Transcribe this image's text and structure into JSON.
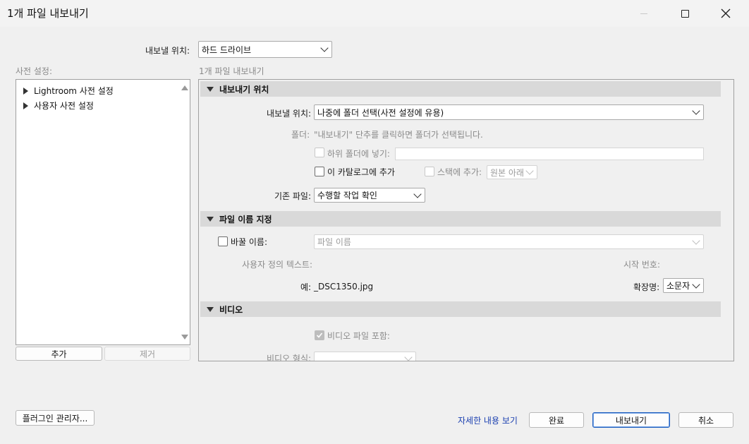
{
  "window": {
    "title": "1개 파일 내보내기"
  },
  "export_to": {
    "label": "내보낼 위치:",
    "value": "하드 드라이브"
  },
  "presets": {
    "header": "사전 설정:",
    "items": [
      {
        "label": "Lightroom 사전 설정"
      },
      {
        "label": "사용자 사전 설정"
      }
    ],
    "add_label": "추가",
    "remove_label": "제거"
  },
  "main": {
    "subtitle": "1개 파일 내보내기",
    "sections": {
      "location": {
        "title": "내보내기 위치",
        "export_to_label": "내보낼 위치:",
        "export_to_value": "나중에 폴더 선택(사전 설정에 유용)",
        "folder_label": "폴더:",
        "folder_hint": "\"내보내기\" 단추를 클릭하면 폴더가 선택됩니다.",
        "subfolder_label": "하위 폴더에 넣기:",
        "add_catalog_label": "이 카탈로그에 추가",
        "add_stack_label": "스택에 추가:",
        "stack_value": "원본 아래",
        "existing_label": "기존 파일:",
        "existing_value": "수행할 작업 확인"
      },
      "naming": {
        "title": "파일 이름 지정",
        "rename_label": "바꿀 이름:",
        "rename_value": "파일 이름",
        "custom_text_label": "사용자 정의 텍스트:",
        "start_number_label": "시작 번호:",
        "example_label": "예:",
        "example_value": "_DSC1350.jpg",
        "extension_label": "확장명:",
        "extension_value": "소문자"
      },
      "video": {
        "title": "비디오",
        "include_label": "비디오 파일 포함:",
        "format_label": "비디오 형식:"
      }
    }
  },
  "footer": {
    "plugin_manager": "플러그인 관리자...",
    "details_link": "자세한 내용 보기",
    "done": "완료",
    "export": "내보내기",
    "cancel": "취소"
  }
}
